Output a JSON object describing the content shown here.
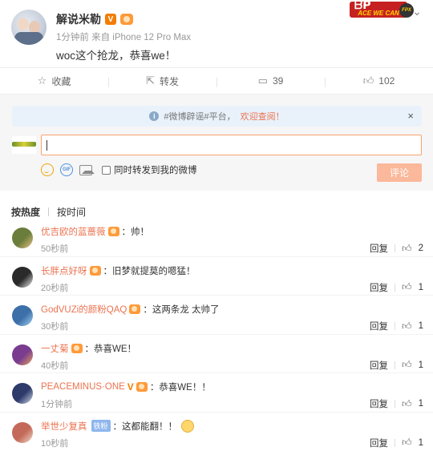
{
  "post": {
    "author": "解说米勒",
    "v_badge": "V",
    "meta": "1分钟前 来自 iPhone 12 Pro Max",
    "content": "woc这个抢龙，恭喜we！",
    "brand_big": "ᗷᑭ",
    "brand_small": "ACE WE CAN",
    "brand_fpx": "FPX"
  },
  "actions": {
    "favorite": "收藏",
    "repost": "转发",
    "comment_count": "39",
    "like_count": "102"
  },
  "notice": {
    "text": "#微博辟谣#平台，",
    "link": "欢迎查阅！",
    "close": "×"
  },
  "composer": {
    "repost_label": "同时转发到我的微博",
    "submit_label": "评论"
  },
  "sort": {
    "hot": "按热度",
    "time": "按时间"
  },
  "comments": [
    {
      "user": "优吉欧的蓝蔷薇",
      "text": "：帅！",
      "time": "50秒前",
      "reply": "回复",
      "likes": "2",
      "av_color": "#6b7d3a",
      "av_accent": "#e7c28a"
    },
    {
      "user": "长胖点好呀",
      "text": "：旧梦就提莫的嗯猛！",
      "time": "20秒前",
      "reply": "回复",
      "likes": "1",
      "av_color": "#2a2a2a",
      "av_accent": "#f0f0f0"
    },
    {
      "user": "GodVUZi的颜粉QAQ",
      "text": "：这两条龙 太帅了",
      "time": "30秒前",
      "reply": "回复",
      "likes": "1",
      "av_color": "#3d6fa8",
      "av_accent": "#9fd3f0"
    },
    {
      "user": "一丈菊",
      "text": "：恭喜WE！",
      "time": "40秒前",
      "reply": "回复",
      "likes": "1",
      "av_color": "#7a3c8f",
      "av_accent": "#e6a55c"
    },
    {
      "user": "PEACEMINUS·ONE",
      "text": "：恭喜WE！！",
      "time": "1分钟前",
      "reply": "回复",
      "likes": "1",
      "av_color": "#2d3a6a",
      "av_accent": "#cfd8ea"
    },
    {
      "user": "举世少复真",
      "tag": "铁粉",
      "text": "：这都能翻！！",
      "time": "10秒前",
      "reply": "回复",
      "likes": "1",
      "av_color": "#c46a5a",
      "av_accent": "#f1d8c6"
    }
  ]
}
